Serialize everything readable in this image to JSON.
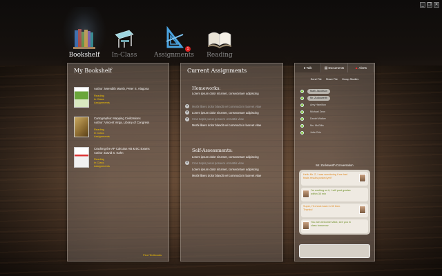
{
  "nav": [
    {
      "label": "Bookshelf",
      "icon": "books-icon",
      "active": true
    },
    {
      "label": "In-Class",
      "icon": "desk-icon",
      "active": false
    },
    {
      "label": "Assignments",
      "icon": "set-square-icon",
      "active": false,
      "badge": "1"
    },
    {
      "label": "Reading",
      "icon": "open-book-icon",
      "active": false
    }
  ],
  "bookshelf": {
    "title": "My Bookshelf",
    "books": [
      {
        "title": "",
        "author": "Author: Meredith Marsh, Peter S. Alagona",
        "links": [
          "Reading",
          "In Class",
          "Assignments"
        ]
      },
      {
        "title": "Cartographia: Mapping Civilizations",
        "author": "Author: Vincent Virga, Library of Congress",
        "links": [
          "Reading",
          "In Class",
          "Assignments"
        ]
      },
      {
        "title": "Cracking the AP Calculus AB & BC Exams",
        "author": "Author: David S. Kahn",
        "links": [
          "Reading",
          "In Class",
          "Assignments"
        ]
      }
    ],
    "find_link": "Find Textbooks"
  },
  "assignments": {
    "title": "Current Assignments",
    "homeworks_title": "Homeworks:",
    "homeworks": [
      {
        "text": "Lorem ipsum dolor sit amet, consectetuer adipiscing",
        "dim": false
      },
      {
        "text": "Morbi libero dolor blandit vel commodo in laoreet vitae",
        "dim": true
      },
      {
        "text": "Lorem ipsum dolor sit amet, consectetuer adipiscing",
        "dim": false
      },
      {
        "text": "Cras turpis purus posuere ut mattis vitae",
        "dim": true
      },
      {
        "text": "Morbi libero dolor blandit vel commodo in laoreet vitae",
        "dim": false
      }
    ],
    "self_title": "Self-Assessments:",
    "self": [
      {
        "text": "Lorem ipsum dolor sit amet, consectetuer adipiscing",
        "dim": false
      },
      {
        "text": "Cras turpis purus posuere ut mattis vitae",
        "dim": true
      },
      {
        "text": "Lorem ipsum dolor sit amet, consectetuer adipiscing",
        "dim": false
      },
      {
        "text": "Morbi libero dolor blandit vel commodo in laoreet vitae",
        "dim": false
      }
    ]
  },
  "sidebar": {
    "tabs": [
      "Talk",
      "Documents",
      "Alerts"
    ],
    "subtabs": [
      "Send File",
      "Share File",
      "Group Studies"
    ],
    "contacts": [
      {
        "name": "Mark Jacobson",
        "online": true
      },
      {
        "name": "Mr. Zuckswerth",
        "online": true
      },
      {
        "name": "Amy Hamilton",
        "online": false
      },
      {
        "name": "Michael Zeon",
        "online": false
      },
      {
        "name": "Daniel Walker",
        "online": false
      },
      {
        "name": "Ms. McGillis",
        "online": false
      },
      {
        "name": "Julia Chin",
        "online": false
      }
    ],
    "conversation_title": "Mr. Zuckswerth Conversation",
    "messages": [
      {
        "text": "Hello Mr. Z, I was wondering if we had finals results posted yet?",
        "side": "left"
      },
      {
        "text": "I'm working on it, I will post grades within 30 min",
        "side": "right"
      },
      {
        "text": "Super, I'll check back in 30 then. Thanks!",
        "side": "left"
      },
      {
        "text": "You are welcome Mark, see you in class tomorrow",
        "side": "right"
      }
    ]
  },
  "colors": {
    "accent_link": "#f5c400",
    "online": "#8ac43f",
    "badge": "#dd2222"
  }
}
